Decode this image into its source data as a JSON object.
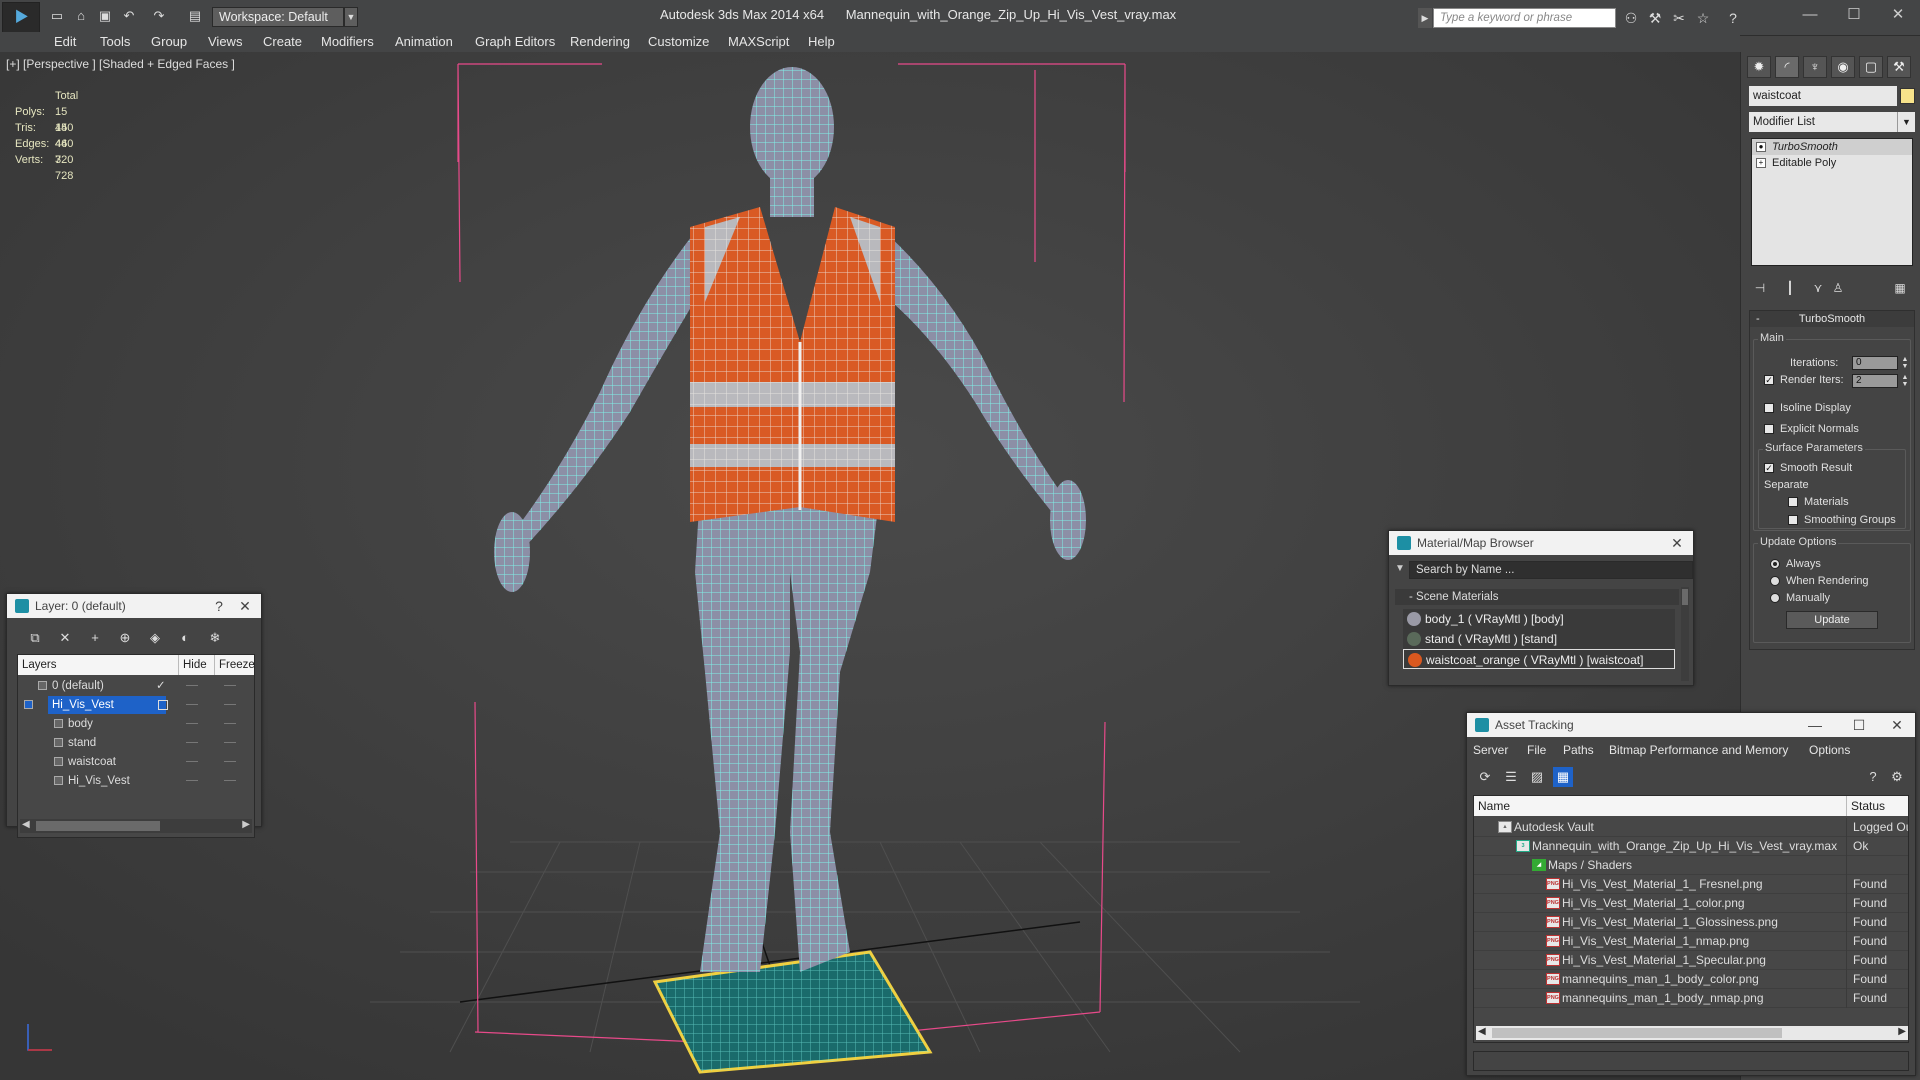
{
  "app": {
    "logo": "3dsmax-logo",
    "workspace": "Workspace: Default",
    "title": "Autodesk 3ds Max  2014 x64",
    "file": "Mannequin_with_Orange_Zip_Up_Hi_Vis_Vest_vray.max",
    "search_placeholder": "Type a keyword or phrase"
  },
  "menu": [
    "Edit",
    "Tools",
    "Group",
    "Views",
    "Create",
    "Modifiers",
    "Animation",
    "Graph Editors",
    "Rendering",
    "Customize",
    "MAXScript",
    "Help"
  ],
  "viewport": {
    "label": "[+] [Perspective ] [Shaded + Edged Faces ]",
    "stats": {
      "header": "Total",
      "rows": [
        {
          "k": "Polys:",
          "v": "15 440"
        },
        {
          "k": "Tris:",
          "v": "15 440"
        },
        {
          "k": "Edges:",
          "v": "46 320"
        },
        {
          "k": "Verts:",
          "v": "7 728"
        }
      ]
    }
  },
  "command_panel": {
    "tabs": [
      "create-icon",
      "modify-icon",
      "hierarchy-icon",
      "motion-icon",
      "display-icon",
      "utilities-icon"
    ],
    "object_name": "waistcoat",
    "object_color": "#f7e38b",
    "modifier_list": "Modifier List",
    "stack": [
      {
        "label": "TurboSmooth",
        "selected": true
      },
      {
        "label": "Editable Poly",
        "selected": false
      }
    ],
    "turbosmooth": {
      "title": "TurboSmooth",
      "main": "Main",
      "iterations_label": "Iterations:",
      "iterations": "0",
      "render_iters_label": "Render Iters:",
      "render_iters": "2",
      "isoline": "Isoline Display",
      "explicit": "Explicit Normals",
      "surface": "Surface Parameters",
      "smooth": "Smooth Result",
      "separate": "Separate",
      "materials": "Materials",
      "smoothing_groups": "Smoothing Groups",
      "update_options": "Update Options",
      "always": "Always",
      "when_rendering": "When Rendering",
      "manually": "Manually",
      "update": "Update"
    }
  },
  "layers": {
    "title": "Layer: 0 (default)",
    "help": "?",
    "col_layers": "Layers",
    "col_hide": "Hide",
    "col_freeze": "Freeze",
    "rows": [
      {
        "label": "0 (default)",
        "indent": 0,
        "selected": false
      },
      {
        "label": "Hi_Vis_Vest",
        "indent": 0,
        "selected": true
      },
      {
        "label": "body",
        "indent": 1,
        "selected": false
      },
      {
        "label": "stand",
        "indent": 1,
        "selected": false
      },
      {
        "label": "waistcoat",
        "indent": 1,
        "selected": false
      },
      {
        "label": "Hi_Vis_Vest",
        "indent": 1,
        "selected": false
      }
    ]
  },
  "material_browser": {
    "title": "Material/Map Browser",
    "search": "Search by Name ...",
    "section": "- Scene Materials",
    "items": [
      {
        "label": "body_1  ( VRayMtl ) [body]",
        "color": "#9a9aa6",
        "selected": false
      },
      {
        "label": "stand  ( VRayMtl ) [stand]",
        "color": "#5a6a5a",
        "selected": false
      },
      {
        "label": "waistcoat_orange  ( VRayMtl ) [waistcoat]",
        "color": "#d9581f",
        "selected": true
      }
    ]
  },
  "asset_tracking": {
    "title": "Asset Tracking",
    "menu": [
      "Server",
      "File",
      "Paths",
      "Bitmap Performance and Memory",
      "Options"
    ],
    "col_name": "Name",
    "col_status": "Status",
    "rows": [
      {
        "name": "Autodesk Vault",
        "status": "Logged Out",
        "indent": 24,
        "icon": "vault-icon"
      },
      {
        "name": "Mannequin_with_Orange_Zip_Up_Hi_Vis_Vest_vray.max",
        "status": "Ok",
        "indent": 44,
        "icon": "max-file-icon"
      },
      {
        "name": "Maps / Shaders",
        "status": "",
        "indent": 58,
        "icon": "maps-icon"
      },
      {
        "name": "Hi_Vis_Vest_Material_1_ Fresnel.png",
        "status": "Found",
        "indent": 72,
        "icon": "png-icon"
      },
      {
        "name": "Hi_Vis_Vest_Material_1_color.png",
        "status": "Found",
        "indent": 72,
        "icon": "png-icon"
      },
      {
        "name": "Hi_Vis_Vest_Material_1_Glossiness.png",
        "status": "Found",
        "indent": 72,
        "icon": "png-icon"
      },
      {
        "name": "Hi_Vis_Vest_Material_1_nmap.png",
        "status": "Found",
        "indent": 72,
        "icon": "png-icon"
      },
      {
        "name": "Hi_Vis_Vest_Material_1_Specular.png",
        "status": "Found",
        "indent": 72,
        "icon": "png-icon"
      },
      {
        "name": "mannequins_man_1_body_color.png",
        "status": "Found",
        "indent": 72,
        "icon": "png-icon"
      },
      {
        "name": "mannequins_man_1_body_nmap.png",
        "status": "Found",
        "indent": 72,
        "icon": "png-icon"
      }
    ]
  }
}
